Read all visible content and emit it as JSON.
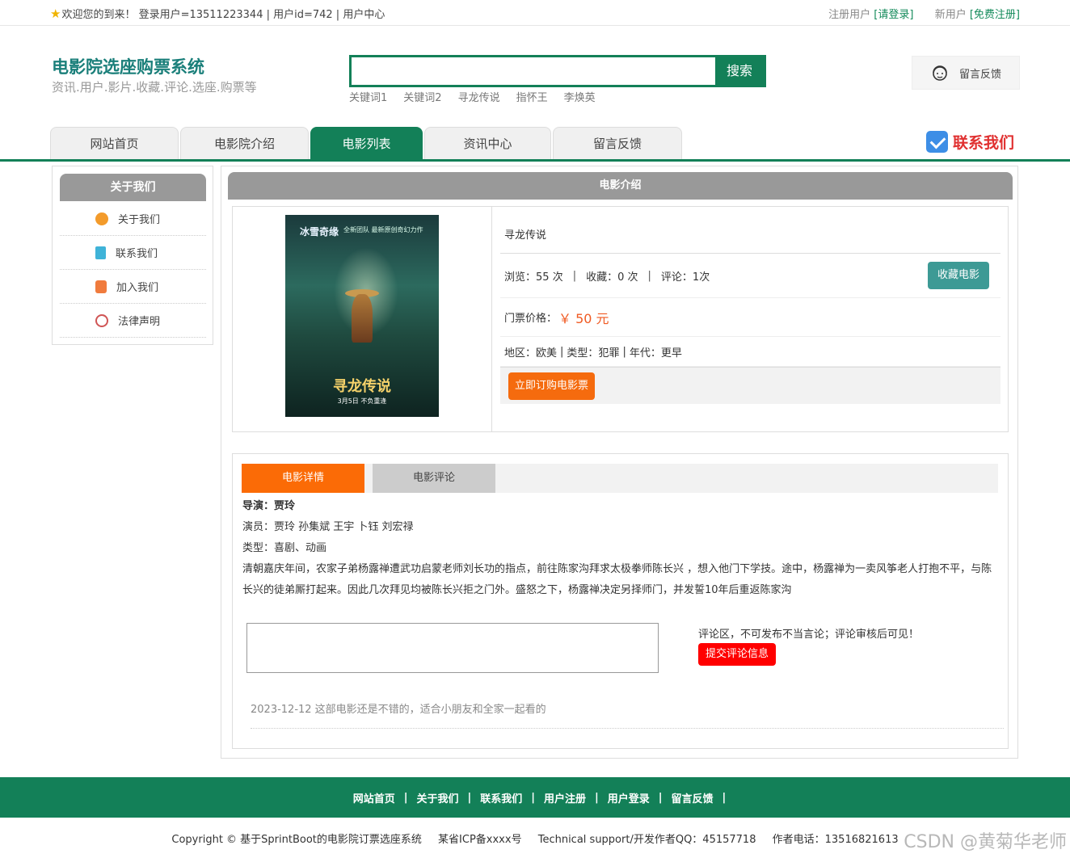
{
  "topbar": {
    "welcome": "欢迎您的到来！ 登录用户=13511223344 | 用户id=742 | 用户中心",
    "registered_prefix": "注册用户",
    "login_link": "[请登录]",
    "new_prefix": "新用户",
    "register_link": "[免费注册]"
  },
  "header": {
    "title": "电影院选座购票系统",
    "subtitle": "资讯.用户.影片.收藏.评论.选座.购票等",
    "search_placeholder": "",
    "search_button": "搜索",
    "hot_keywords": [
      "关键词1",
      "关键词2",
      "寻龙传说",
      "指怀王",
      "李焕英"
    ],
    "feedback_label": "留言反馈"
  },
  "nav": {
    "tabs": [
      {
        "label": "网站首页"
      },
      {
        "label": "电影院介绍"
      },
      {
        "label": "电影列表"
      },
      {
        "label": "资讯中心"
      },
      {
        "label": "留言反馈"
      }
    ],
    "contact_label": "联系我们"
  },
  "sidebar": {
    "title": "关于我们",
    "items": [
      {
        "label": "关于我们",
        "icon": "about-icon",
        "color": "#f39b2b"
      },
      {
        "label": "联系我们",
        "icon": "clipboard-icon",
        "color": "#3fb3d8"
      },
      {
        "label": "加入我们",
        "icon": "lock-icon",
        "color": "#f07b3d"
      },
      {
        "label": "法律声明",
        "icon": "power-icon",
        "color": "#d05555"
      }
    ]
  },
  "movie": {
    "panel_title": "电影介绍",
    "poster": {
      "top_text": "冰雪奇缘",
      "top_text2": "全新团队 最新原创奇幻力作",
      "title": "寻龙传说",
      "date": "3月5日 不负重逢"
    },
    "name": "寻龙传说",
    "views_label": "浏览：",
    "views": "55 次",
    "favs_label": "收藏：",
    "favs": "0 次",
    "comments_label": "评论：",
    "comments": "1次",
    "fav_button": "收藏电影",
    "price_label": "门票价格：",
    "price": "￥ 50 元",
    "region_label": "地区：",
    "region": "欧美",
    "genre_label": "类型：",
    "genre": "犯罪",
    "era_label": "年代：",
    "era": "更早",
    "buy_button": "立即订购电影票"
  },
  "tabs": {
    "details_tab": "电影详情",
    "comments_tab": "电影评论"
  },
  "details": {
    "director": "导演：贾玲",
    "actors": "演员：贾玲 孙集斌  王宇   卜钰 刘宏禄",
    "type": "类型：喜剧、动画",
    "synopsis": "清朝嘉庆年间，农家子弟杨露禅遭武功启蒙老师刘长功的指点，前往陈家沟拜求太极拳师陈长兴 ，想入他门下学技。途中，杨露禅为一卖风筝老人打抱不平，与陈长兴的徒弟厮打起来。因此几次拜见均被陈长兴拒之门外。盛怒之下，杨露禅决定另择师门，并发誓10年后重返陈家沟"
  },
  "comment_form": {
    "note": "评论区，不可发布不当言论；评论审核后可见！",
    "submit": "提交评论信息",
    "entry": "2023-12-12 这部电影还是不错的，适合小朋友和全家一起看的"
  },
  "footer": {
    "links": [
      "网站首页",
      "关于我们",
      "联系我们",
      "用户注册",
      "用户登录",
      "留言反馈"
    ],
    "copyright": "Copyright © 基于SprintBoot的电影院订票选座系统",
    "icp": "某省ICP备xxxx号",
    "support": "Technical support/开发作者QQ：45157718",
    "phone": "作者电话：13516821613",
    "watermark": "CSDN @黄菊华老师"
  }
}
